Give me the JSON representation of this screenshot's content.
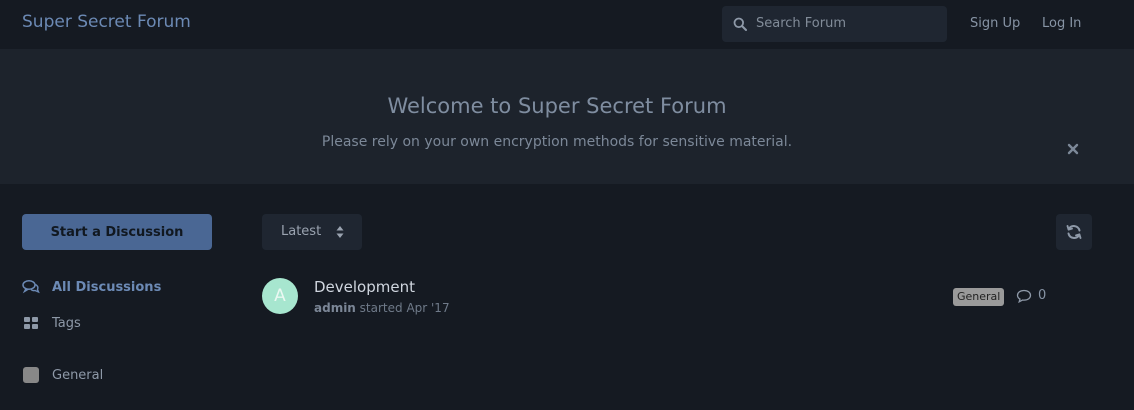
{
  "header": {
    "site_title": "Super Secret Forum",
    "search_placeholder": "Search Forum",
    "sign_up": "Sign Up",
    "log_in": "Log In"
  },
  "hero": {
    "title": "Welcome to Super Secret Forum",
    "subtitle": "Please rely on your own encryption methods for sensitive material.",
    "close_icon": "close-icon"
  },
  "sidebar": {
    "start_button": "Start a Discussion",
    "items": [
      {
        "label": "All Discussions",
        "icon": "comments-icon",
        "active": true
      },
      {
        "label": "Tags",
        "icon": "grid-icon",
        "active": false
      },
      {
        "label": "General",
        "icon": "tag-swatch",
        "active": false
      }
    ]
  },
  "toolbar": {
    "sort_label": "Latest",
    "refresh_icon": "refresh-icon"
  },
  "discussions": [
    {
      "avatar_letter": "A",
      "title": "Development",
      "author": "admin",
      "meta": " started Apr '17",
      "tag": "General",
      "replies": "0"
    }
  ],
  "colors": {
    "background": "#151a22",
    "hero": "#1d232c",
    "accent": "#6c8ab5",
    "primary_button": "#4a6794",
    "avatar": "#a7e6cf",
    "tag": "#9a9a9a"
  }
}
